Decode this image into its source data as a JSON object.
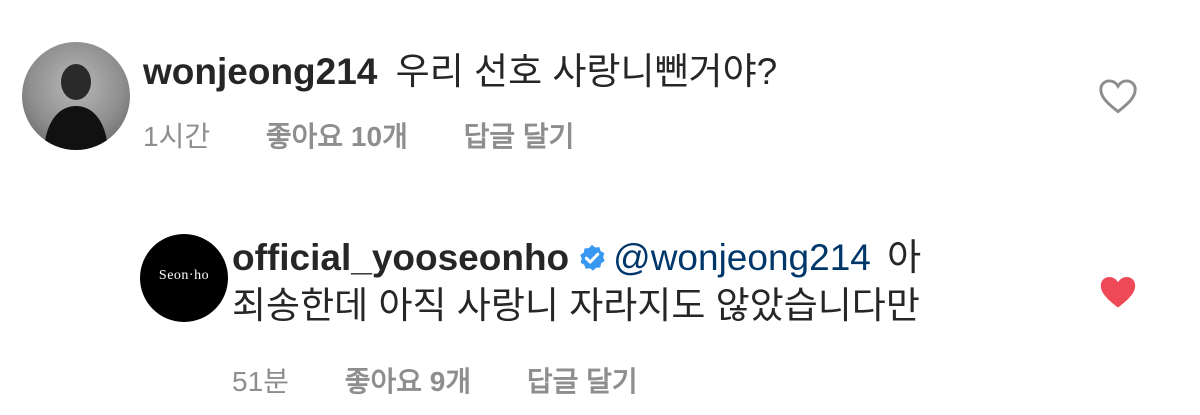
{
  "comments": [
    {
      "username": "wonjeong214",
      "text": "우리 선호 사랑니뺀거야?",
      "time": "1시간",
      "likes": "좋아요 10개",
      "reply": "답글 달기",
      "liked": false
    },
    {
      "username": "official_yooseonho",
      "verified": true,
      "avatar_text": "Seon·ho",
      "mention": "@wonjeong214",
      "text_line1": "아",
      "text_line2": "죄송한데 아직 사랑니 자라지도 않았습니다만",
      "time": "51분",
      "likes": "좋아요 9개",
      "reply": "답글 달기",
      "liked": true
    }
  ],
  "colors": {
    "text": "#262626",
    "meta": "#8e8e8e",
    "mention": "#00376b",
    "verified": "#3897f0",
    "heart_liked": "#ed4956"
  }
}
